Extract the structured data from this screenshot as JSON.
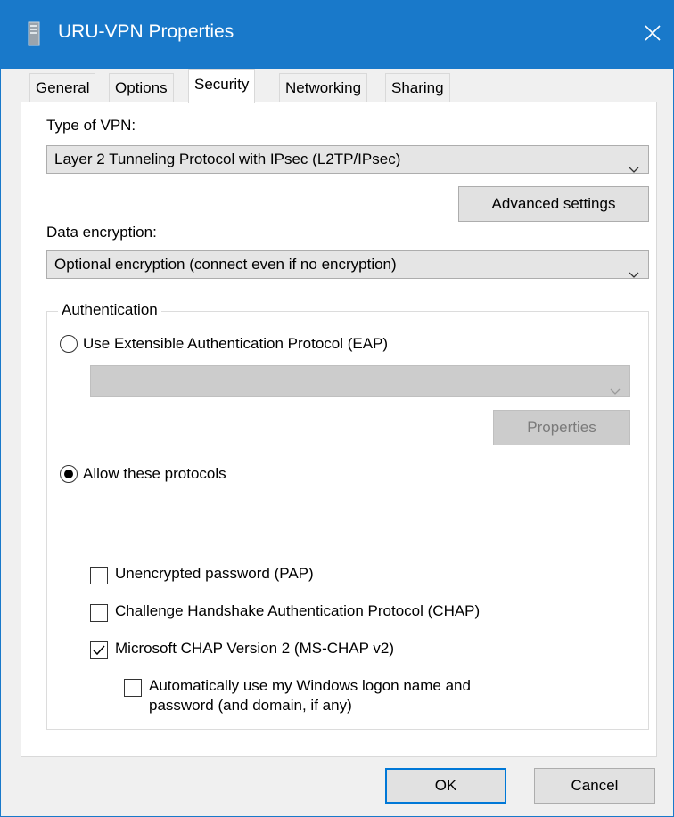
{
  "window": {
    "title": "URU-VPN Properties",
    "accent_color": "#1979ca"
  },
  "tabs": [
    {
      "label": "General"
    },
    {
      "label": "Options"
    },
    {
      "label": "Security",
      "active": true
    },
    {
      "label": "Networking"
    },
    {
      "label": "Sharing"
    }
  ],
  "security": {
    "vpn_type_label": "Type of VPN:",
    "vpn_type_value": "Layer 2 Tunneling Protocol with IPsec (L2TP/IPsec)",
    "advanced_settings_label": "Advanced settings",
    "encryption_label": "Data encryption:",
    "encryption_value": "Optional encryption (connect even if no encryption)",
    "authentication": {
      "group_title": "Authentication",
      "eap_radio_label": "Use Extensible Authentication Protocol (EAP)",
      "eap_selected": false,
      "eap_combo_value": "",
      "properties_label": "Properties",
      "allow_radio_label": "Allow these protocols",
      "allow_selected": true,
      "protocols": [
        {
          "label": "Unencrypted password (PAP)",
          "checked": false
        },
        {
          "label": "Challenge Handshake Authentication Protocol (CHAP)",
          "checked": false
        },
        {
          "label": "Microsoft CHAP Version 2 (MS-CHAP v2)",
          "checked": true
        }
      ],
      "auto_logon_label_line1": "Automatically use my Windows logon name and",
      "auto_logon_label_line2": "password (and domain, if any)",
      "auto_logon_checked": false
    }
  },
  "buttons": {
    "ok": "OK",
    "cancel": "Cancel"
  },
  "icons": {
    "title": "vpn-connection-icon",
    "close": "close-icon",
    "chevron": "chevron-down-icon",
    "checkmark": "checkmark-icon"
  }
}
